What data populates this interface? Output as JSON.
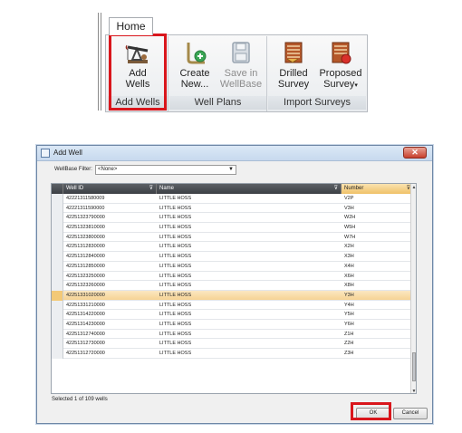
{
  "ribbon": {
    "tab_home": "Home",
    "groups": {
      "add_wells": {
        "label": "Add Wells",
        "add_wells_button": [
          "Add",
          "Wells"
        ]
      },
      "well_plans": {
        "label": "Well Plans",
        "create_new_button": [
          "Create",
          "New..."
        ],
        "save_in_wellbase_button": [
          "Save in",
          "WellBase"
        ]
      },
      "import_surveys": {
        "label": "Import Surveys",
        "drilled_survey_button": [
          "Drilled",
          "Survey"
        ],
        "proposed_survey_button": [
          "Proposed",
          "Survey"
        ]
      }
    }
  },
  "dialog": {
    "title": "Add Well",
    "filter_label": "WellBase Filter:",
    "filter_value": "<None>",
    "columns": {
      "well_id": "Well ID",
      "name": "Name",
      "number": "Number"
    },
    "rows": [
      {
        "well_id": "42221311580009",
        "name": "LITTLE HOSS",
        "number": "V2P",
        "selected": false
      },
      {
        "well_id": "42221311590000",
        "name": "LITTLE HOSS",
        "number": "V3H",
        "selected": false
      },
      {
        "well_id": "42251323790000",
        "name": "LITTLE HOSS",
        "number": "W2H",
        "selected": false
      },
      {
        "well_id": "42251323810000",
        "name": "LITTLE HOSS",
        "number": "W5H",
        "selected": false
      },
      {
        "well_id": "42251323800000",
        "name": "LITTLE HOSS",
        "number": "W7H",
        "selected": false
      },
      {
        "well_id": "42251312830000",
        "name": "LITTLE HOSS",
        "number": "X2H",
        "selected": false
      },
      {
        "well_id": "42251312840000",
        "name": "LITTLE HOSS",
        "number": "X3H",
        "selected": false
      },
      {
        "well_id": "42251312850000",
        "name": "LITTLE HOSS",
        "number": "X4H",
        "selected": false
      },
      {
        "well_id": "42251323250000",
        "name": "LITTLE HOSS",
        "number": "X6H",
        "selected": false
      },
      {
        "well_id": "42251323260000",
        "name": "LITTLE HOSS",
        "number": "X8H",
        "selected": false
      },
      {
        "well_id": "42251331020000",
        "name": "LITTLE HOSS",
        "number": "Y3H",
        "selected": true
      },
      {
        "well_id": "42251331210000",
        "name": "LITTLE HOSS",
        "number": "Y4H",
        "selected": false
      },
      {
        "well_id": "42251314220000",
        "name": "LITTLE HOSS",
        "number": "Y5H",
        "selected": false
      },
      {
        "well_id": "42251314230000",
        "name": "LITTLE HOSS",
        "number": "Y6H",
        "selected": false
      },
      {
        "well_id": "42251312740000",
        "name": "LITTLE HOSS",
        "number": "Z1H",
        "selected": false
      },
      {
        "well_id": "42251312730000",
        "name": "LITTLE HOSS",
        "number": "Z2H",
        "selected": false
      },
      {
        "well_id": "42251312720000",
        "name": "LITTLE HOSS",
        "number": "Z3H",
        "selected": false
      }
    ],
    "status": "Selected 1 of 109 wells",
    "ok_label": "OK",
    "cancel_label": "Cancel"
  },
  "colors": {
    "highlight": "#d9161c",
    "selected_row": "#f6d394",
    "header": "#4a4e54"
  },
  "icons": [
    "pumpjack-icon",
    "well-plan-icon",
    "save-icon",
    "drilled-survey-icon",
    "proposed-survey-icon",
    "filter-icon",
    "dropdown-icon",
    "close-icon"
  ]
}
